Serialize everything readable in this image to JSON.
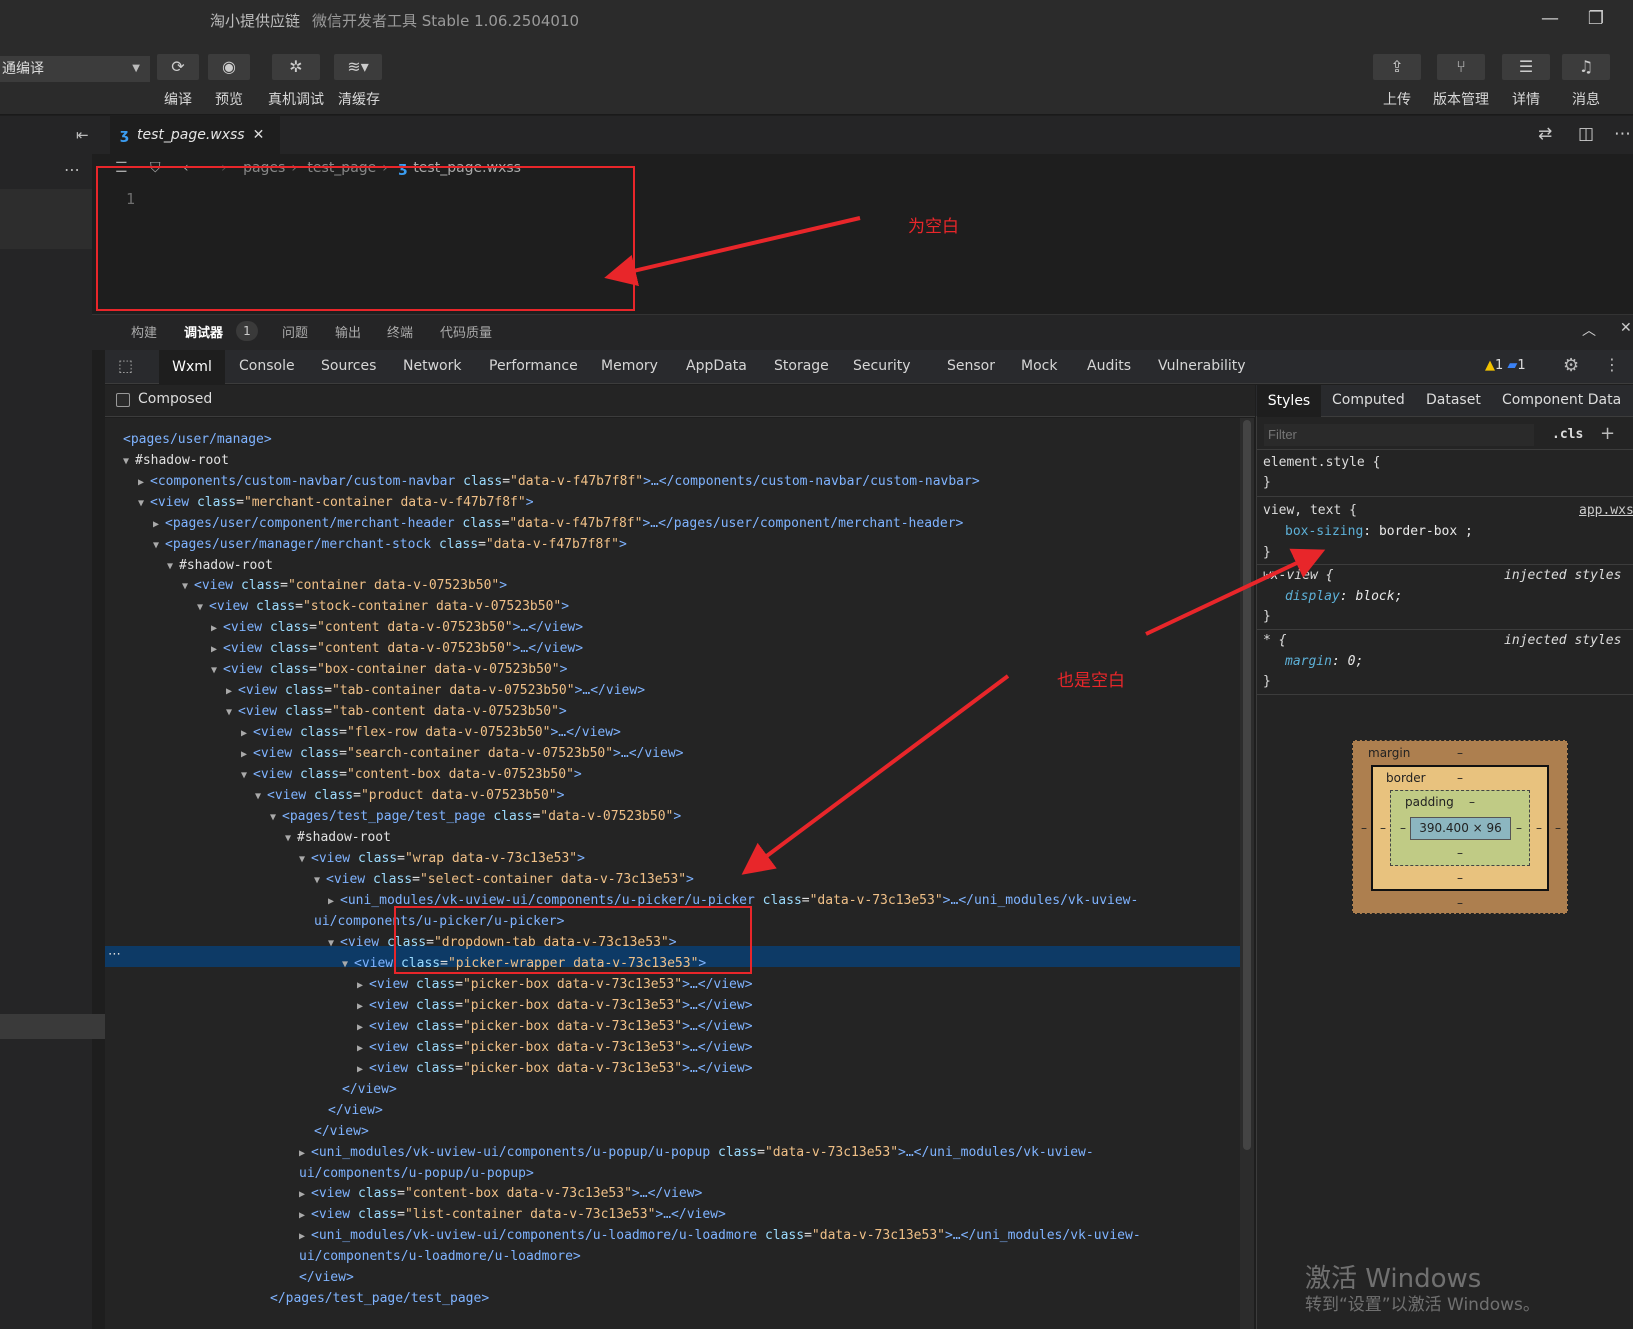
{
  "window": {
    "app_name": "淘小提供应链",
    "subtitle": "微信开发者工具 Stable 1.06.2504010",
    "minimize_icon": "minimize-icon",
    "restore_icon": "restore-icon"
  },
  "toolbar": {
    "compile_mode": "通编译",
    "left_buttons": [
      {
        "label": "编译",
        "icon": "refresh-icon"
      },
      {
        "label": "预览",
        "icon": "eye-icon"
      },
      {
        "label": "真机调试",
        "icon": "bug-icon"
      },
      {
        "label": "清缓存",
        "icon": "layers-icon"
      }
    ],
    "right_buttons": [
      {
        "label": "上传",
        "icon": "upload-icon"
      },
      {
        "label": "版本管理",
        "icon": "branch-icon"
      },
      {
        "label": "详情",
        "icon": "menu-icon"
      },
      {
        "label": "消息",
        "icon": "bell-icon"
      }
    ]
  },
  "editor": {
    "file_tab": "test_page.wxss",
    "breadcrumb": [
      "pages",
      "test_page",
      "test_page.wxss"
    ],
    "line_number": "1"
  },
  "annotations": {
    "top_note": "为空白",
    "middle_note": "也是空白",
    "color": "#e8262a"
  },
  "panel_tabs": [
    "构建",
    "调试器",
    "问题",
    "输出",
    "终端",
    "代码质量"
  ],
  "panel_badge": "1",
  "devtools_tabs": [
    "Wxml",
    "Console",
    "Sources",
    "Network",
    "Performance",
    "Memory",
    "AppData",
    "Storage",
    "Security",
    "Sensor",
    "Mock",
    "Audits",
    "Vulnerability"
  ],
  "devtools_status": {
    "warnings": "1",
    "messages": "1"
  },
  "composed_label": "Composed",
  "tree_rows": [
    "<pages/user/manage>",
    "▼#shadow-root",
    "▶<components/custom-navbar/custom-navbar class=\"data-v-f47b7f8f\">…</components/custom-navbar/custom-navbar>",
    "▼<view class=\"merchant-container data-v-f47b7f8f\">",
    "▶<pages/user/component/merchant-header class=\"data-v-f47b7f8f\">…</pages/user/component/merchant-header>",
    "▼<pages/user/manager/merchant-stock class=\"data-v-f47b7f8f\">",
    "▼#shadow-root",
    "▼<view class=\"container data-v-07523b50\">",
    "▼<view class=\"stock-container data-v-07523b50\">",
    "▶<view class=\"content data-v-07523b50\">…</view>",
    "▶<view class=\"content data-v-07523b50\">…</view>",
    "▼<view class=\"box-container data-v-07523b50\">",
    "▶<view class=\"tab-container data-v-07523b50\">…</view>",
    "▼<view class=\"tab-content data-v-07523b50\">",
    "▶<view class=\"flex-row data-v-07523b50\">…</view>",
    "▶<view class=\"search-container data-v-07523b50\">…</view>",
    "▼<view class=\"content-box data-v-07523b50\">",
    "▼<view class=\"product data-v-07523b50\">",
    "▼<pages/test_page/test_page class=\"data-v-07523b50\">",
    "▼#shadow-root",
    "▼<view class=\"wrap data-v-73c13e53\">",
    "▼<view class=\"select-container data-v-73c13e53\">",
    "▶<uni_modules/vk-uview-ui/components/u-picker/u-picker class=\"data-v-73c13e53\">…</uni_modules/vk-uview-",
    "ui/components/u-picker/u-picker>",
    "▼<view class=\"dropdown-tab data-v-73c13e53\">",
    "▼<view class=\"picker-wrapper data-v-73c13e53\">",
    "▶<view class=\"picker-box data-v-73c13e53\">…</view>",
    "▶<view class=\"picker-box data-v-73c13e53\">…</view>",
    "▶<view class=\"picker-box data-v-73c13e53\">…</view>",
    "▶<view class=\"picker-box data-v-73c13e53\">…</view>",
    "▶<view class=\"picker-box data-v-73c13e53\">…</view>",
    "</view>",
    "</view>",
    "</view>",
    "▶<uni_modules/vk-uview-ui/components/u-popup/u-popup class=\"data-v-73c13e53\">…</uni_modules/vk-uview-",
    "ui/components/u-popup/u-popup>",
    "▶<view class=\"content-box data-v-73c13e53\">…</view>",
    "▶<view class=\"list-container data-v-73c13e53\">…</view>",
    "▶<uni_modules/vk-uview-ui/components/u-loadmore/u-loadmore class=\"data-v-73c13e53\">…</uni_modules/vk-uview-",
    "ui/components/u-loadmore/u-loadmore>",
    "</view>",
    "</pages/test_page/test_page>"
  ],
  "styles": {
    "tabs": [
      "Styles",
      "Computed",
      "Dataset",
      "Component Data"
    ],
    "filter_placeholder": "Filter",
    "cls_label": ".cls",
    "add_label": "+",
    "element_style": "element.style {",
    "close_brace": "}",
    "rule1_selector": "view, text {",
    "rule1_source": "app.wxs",
    "rule1_prop": "box-sizing",
    "rule1_value": "border-box ;",
    "rule2_selector": "wx-view {",
    "rule2_source": "injected styles",
    "rule2_prop": "display",
    "rule2_value": "block;",
    "rule3_selector": "* {",
    "rule3_source": "injected styles",
    "rule3_prop": "margin",
    "rule3_value": "0;"
  },
  "box_model": {
    "margin_label": "margin",
    "border_label": "border",
    "padding_label": "padding",
    "content_size": "390.400 × 96",
    "dash": "–"
  },
  "watermark": {
    "line1": "激活 Windows",
    "line2": "转到“设置”以激活 Windows。"
  }
}
